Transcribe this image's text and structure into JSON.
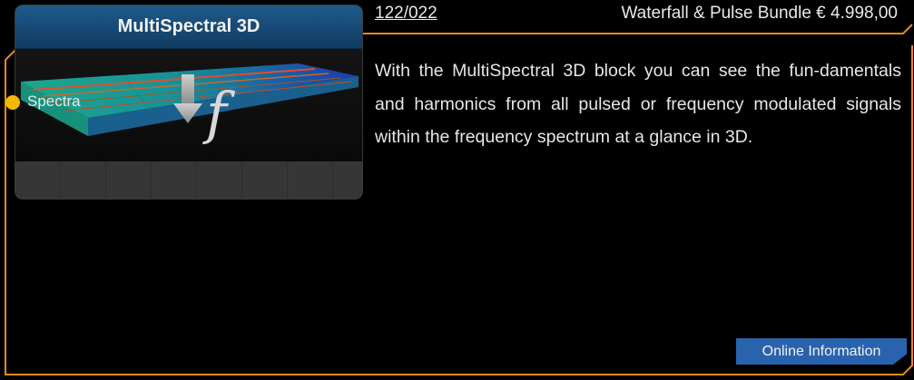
{
  "block": {
    "title": "MultiSpectral 3D",
    "port_label": "Spectra",
    "icon": "spectrum-waterfall-icon"
  },
  "header": {
    "article_number": "122/022",
    "product": "Waterfall & Pulse Bundle € 4.998,00"
  },
  "description": "With the MultiSpectral 3D block you can see the fun-damentals and harmonics from all pulsed or frequency modulated signals within the frequency spectrum at a glance in 3D.",
  "button": {
    "label": "Online Information"
  },
  "colors": {
    "accent": "#e8891c",
    "title_bar": "#1a4f7c",
    "port": "#f5b800",
    "button": "#2a63ad"
  }
}
